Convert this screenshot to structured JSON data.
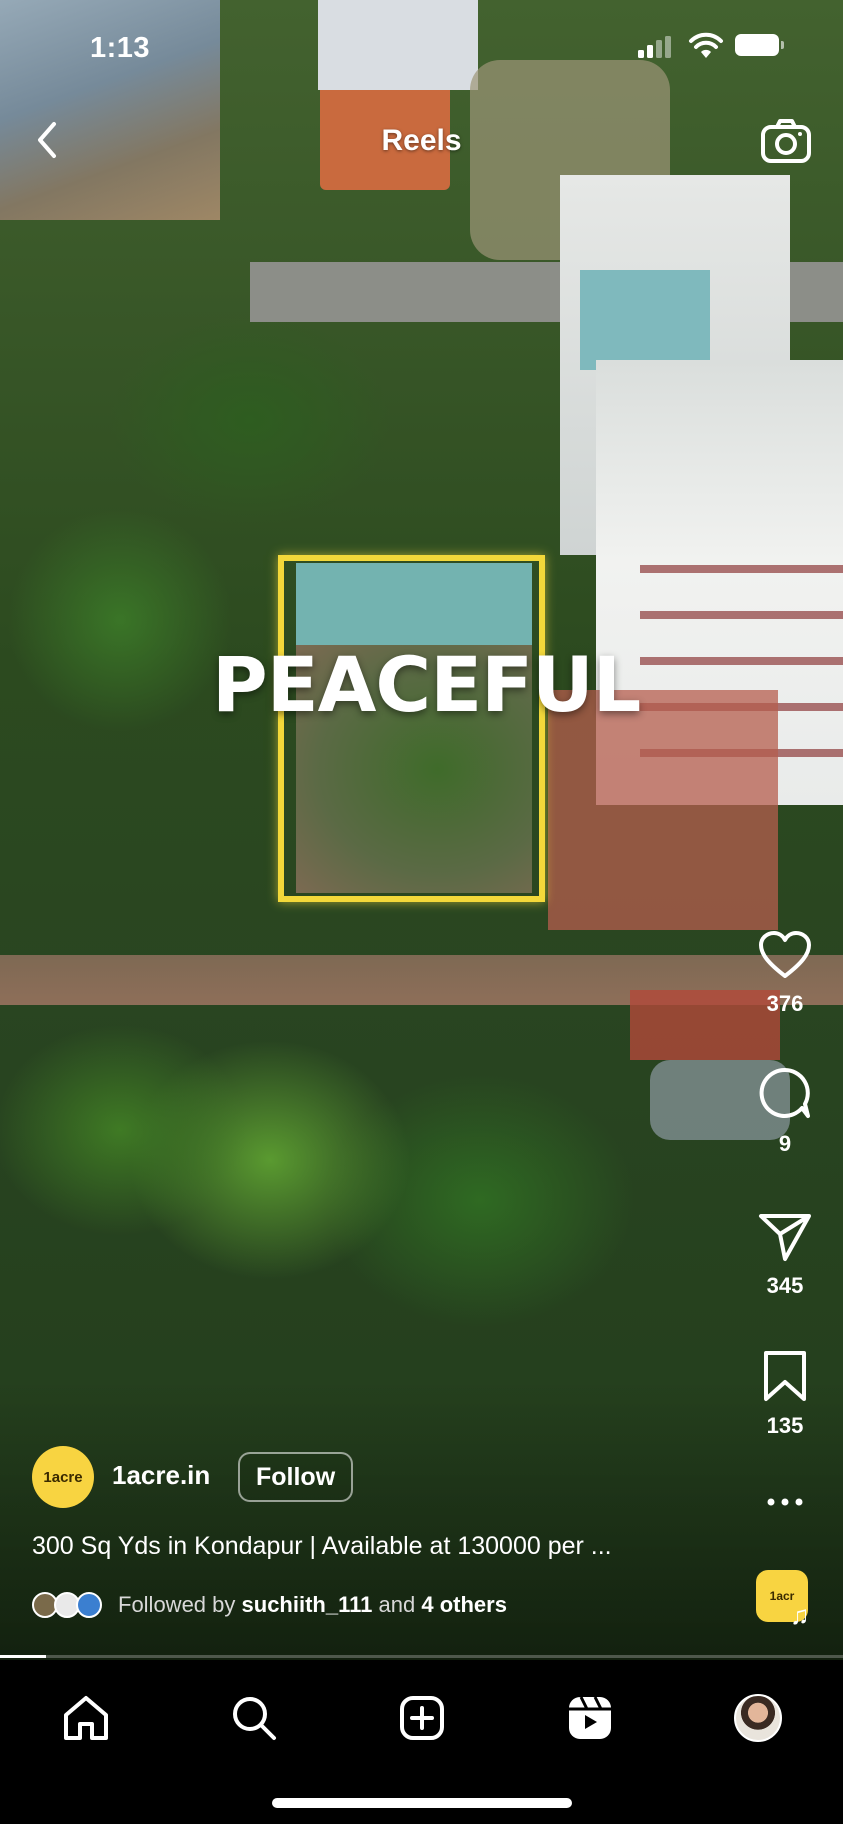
{
  "status_bar": {
    "time": "1:13"
  },
  "header": {
    "title": "Reels"
  },
  "reel": {
    "overlay_text": "PEACEFUL",
    "account": {
      "avatar_text": "1acre",
      "username": "1acre.in",
      "follow_label": "Follow"
    },
    "caption": "300 Sq Yds in Kondapur | Available at 130000 per ...",
    "followed_by": {
      "prefix": "Followed by",
      "user": "suchiith_111",
      "joiner": "and",
      "others": "4 others"
    },
    "audio_avatar_text": "1acr",
    "progress": 0.055
  },
  "actions": {
    "likes": "376",
    "comments": "9",
    "shares": "345",
    "saves": "135"
  },
  "nav": {
    "items": [
      "home-icon",
      "search-icon",
      "create-icon",
      "reels-icon",
      "profile-avatar"
    ]
  },
  "colors": {
    "highlight": "#f3d83a",
    "brand_yellow": "#f8d441"
  }
}
